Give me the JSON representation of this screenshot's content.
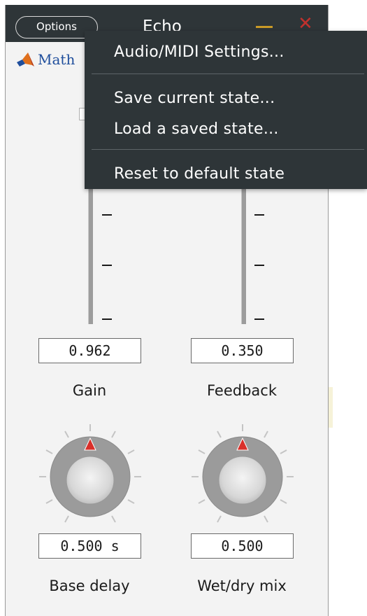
{
  "window": {
    "title": "Echo",
    "options_label": "Options",
    "logo_text": "Math"
  },
  "controls": {
    "gain": {
      "value": "0.962",
      "label": "Gain"
    },
    "feedback": {
      "value": "0.350",
      "label": "Feedback"
    },
    "base_delay": {
      "value": "0.500 s",
      "label": "Base delay"
    },
    "wet_dry": {
      "value": "0.500",
      "label": "Wet/dry mix"
    }
  },
  "menu": {
    "items": [
      {
        "label": "Audio/MIDI Settings..."
      },
      {
        "label": "Save current state..."
      },
      {
        "label": "Load a saved state..."
      },
      {
        "label": "Reset to default state"
      }
    ]
  },
  "colors": {
    "titlebar": "#2e3538",
    "minimize": "#c99a27",
    "close": "#c0312d",
    "knob_pointer": "#d9302a"
  }
}
